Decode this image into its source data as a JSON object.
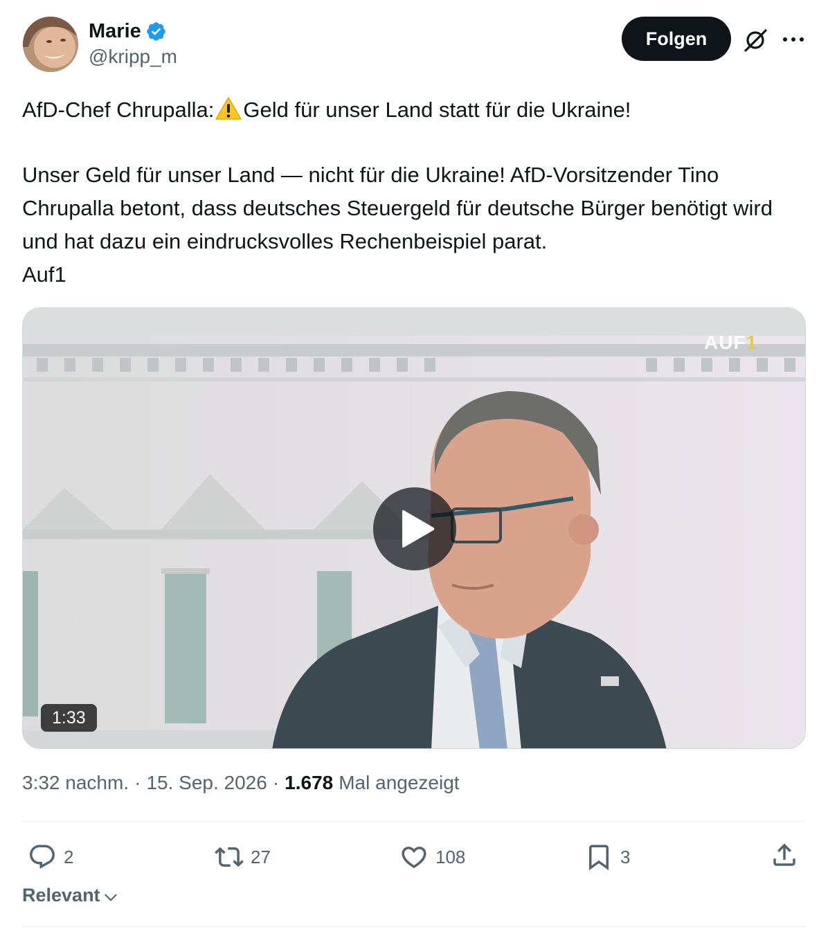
{
  "author": {
    "display_name": "Marie",
    "handle": "@kripp_m",
    "verified": true
  },
  "header": {
    "follow_label": "Folgen"
  },
  "tweet": {
    "line1_before": "AfD-Chef Chrupalla:",
    "line1_after": "Geld für unser Land statt für die Ukraine!",
    "paragraph2": "Unser Geld für unser Land — nicht für die Ukraine! AfD-Vorsitzender Tino Chrupalla betont, dass deutsches Steuergeld für deutsche Bürger benötigt wird und hat dazu ein eindrucksvolles Rechenbeispiel parat.",
    "paragraph3": "Auf1"
  },
  "media": {
    "type": "video",
    "duration": "1:33",
    "channel_logo_text": "AUF",
    "channel_logo_number": "1"
  },
  "meta": {
    "time": "3:32 nachm.",
    "separator": "·",
    "date": "15. Sep. 2026",
    "views_count": "1.678",
    "views_label": "Mal angezeigt"
  },
  "actions": {
    "replies": "2",
    "reposts": "27",
    "likes": "108",
    "bookmarks": "3"
  },
  "sort": {
    "label": "Relevant"
  },
  "colors": {
    "verified_blue": "#1d9bf0",
    "text_primary": "#0f1419",
    "text_secondary": "#536471",
    "follow_button_bg": "#0f1419"
  }
}
